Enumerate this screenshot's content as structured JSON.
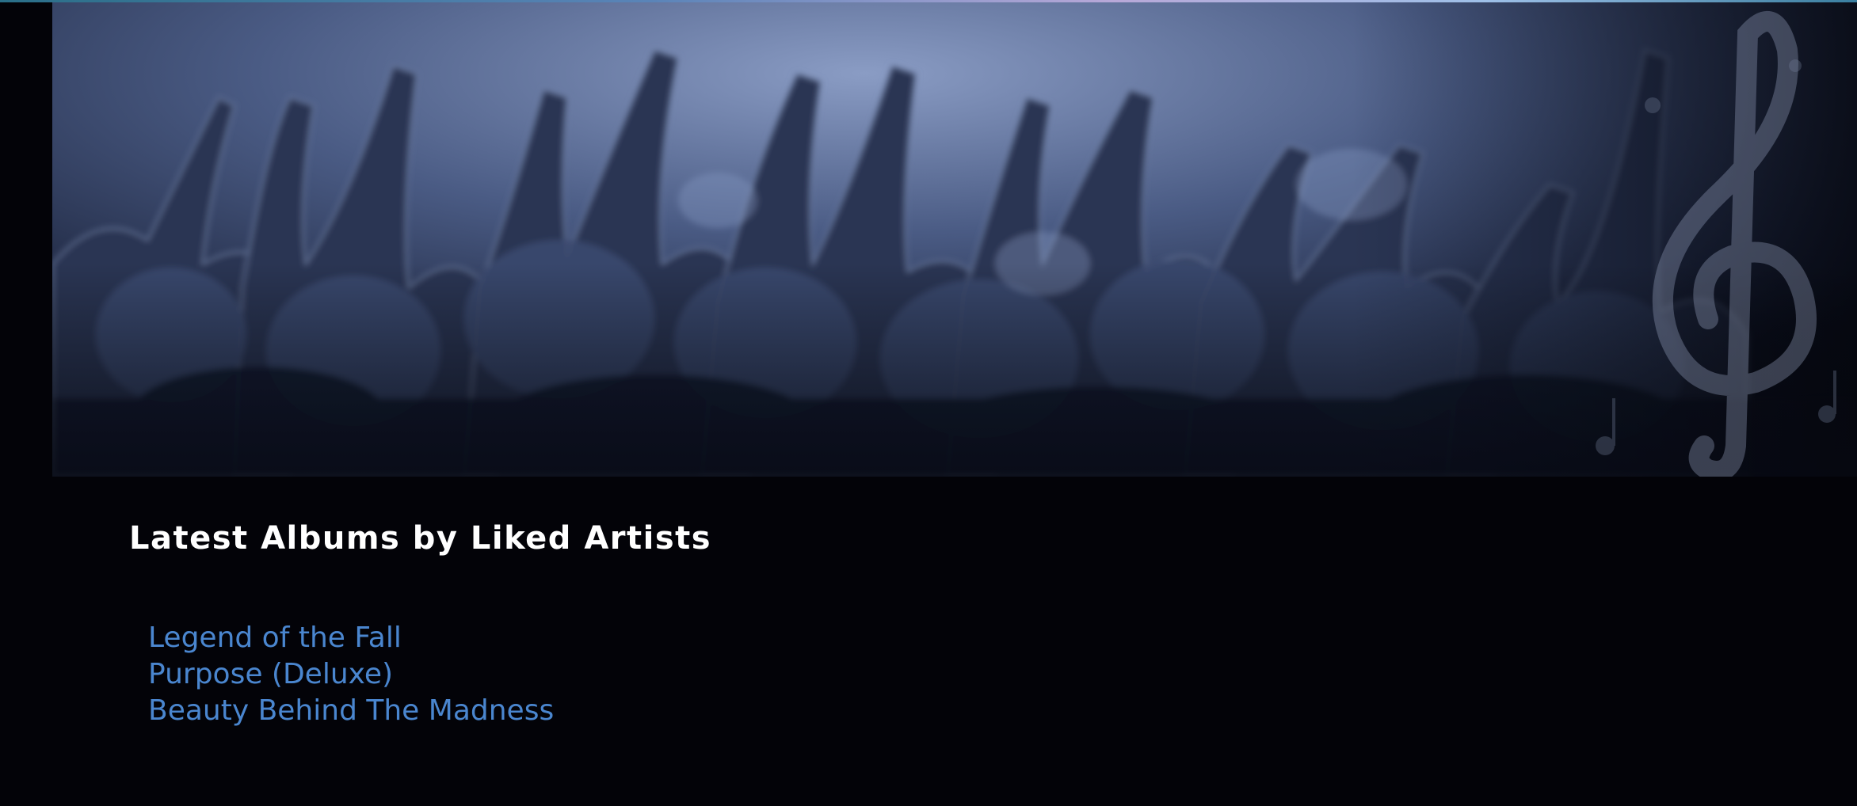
{
  "banner": {
    "image": "concert-crowd-hero",
    "decoration": "treble-clef-icon"
  },
  "section": {
    "title": "Latest Albums by Liked Artists"
  },
  "albums": [
    {
      "title": "Legend of the Fall"
    },
    {
      "title": "Purpose (Deluxe)"
    },
    {
      "title": "Beauty Behind The Madness"
    }
  ],
  "colors": {
    "background": "#030308",
    "title": "#ffffff",
    "link": "#4a86cf",
    "banner_tint": "#5b6f9c"
  }
}
